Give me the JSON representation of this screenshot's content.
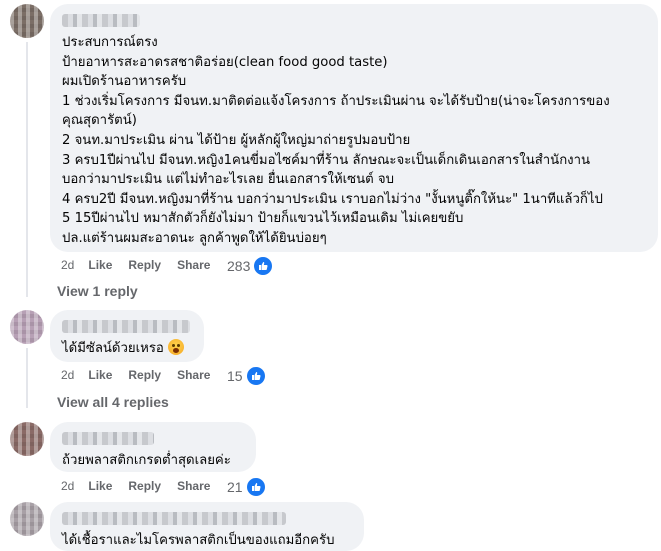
{
  "comments": [
    {
      "lines": [
        "ประสบการณ์ตรง",
        "ป้ายอาหารสะอาดรสชาติอร่อย(clean food good taste)",
        "ผมเปิดร้านอาหารครับ",
        "1 ช่วงเริ่มโครงการ มีจนท.มาติดต่อแจ้งโครงการ ถ้าประเมินผ่าน จะได้รับป้าย(น่าจะโครงการของ",
        "คุณสุดารัตน์)",
        "2 จนท.มาประเมิน ผ่าน ได้ป้าย ผู้หลักผู้ใหญ่มาถ่ายรูปมอบป้าย",
        "3 ครบ1ปีผ่านไป มีจนท.หญิง1คนขี่มอไซค์มาที่ร้าน ลักษณะจะเป็นเด็กเดินเอกสารในสำนักงาน",
        "บอกว่ามาประเมิน แต่ไม่ทำอะไรเลย ยื่นเอกสารให้เซนต์ จบ",
        "4 ครบ2ปี มีจนท.หญิงมาที่ร้าน บอกว่ามาประเมิน เราบอกไม่ว่าง \"งั้นหนูติ๊กให้นะ\" 1นาทีแล้วก็ไป",
        "5 15ปีผ่านไป หมาสักตัวก็ยังไม่มา ป้ายก็แขวนไว้เหมือนเดิม ไม่เคยขยับ",
        "ปล.แต่ร้านผมสะอาดนะ ลูกค้าพูดให้ได้ยินบ่อยๆ"
      ],
      "time": "2d",
      "like": "Like",
      "reply": "Reply",
      "share": "Share",
      "reactions": "283",
      "replies_link": "View 1 reply"
    },
    {
      "lines": [
        "ได้มีซัลน์ด้วยเหรอ"
      ],
      "emoji": "astonished-face",
      "time": "2d",
      "like": "Like",
      "reply": "Reply",
      "share": "Share",
      "reactions": "15",
      "replies_link": "View all 4 replies"
    },
    {
      "lines": [
        "ถ้วยพลาสติกเกรดต่ำสุดเลยค่ะ"
      ],
      "time": "2d",
      "like": "Like",
      "reply": "Reply",
      "share": "Share",
      "reactions": "21"
    },
    {
      "lines": [
        "ได้เชื้อราและไมโครพลาสติกเป็นของแถมอีกครับ"
      ]
    }
  ],
  "colors": {
    "avatar1": "#7b6e66",
    "avatar2": "#b7a0b5",
    "avatar3": "#8a6a66",
    "avatar4": "#a8a0a6",
    "like_blue": "#1877f2"
  }
}
